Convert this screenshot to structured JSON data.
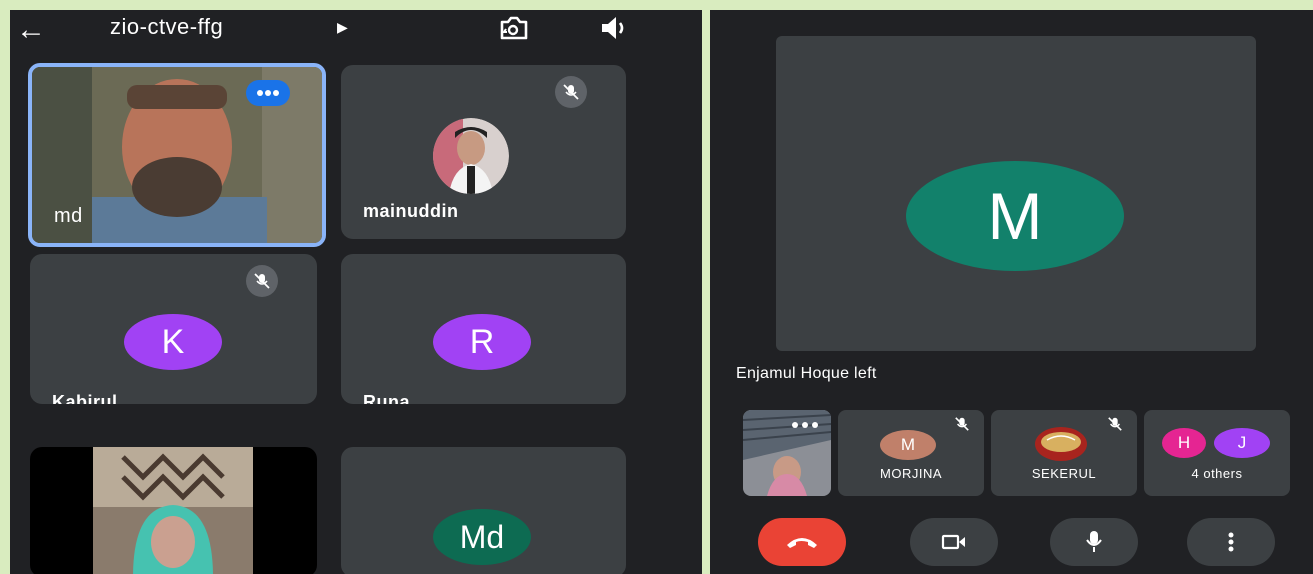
{
  "left_screen": {
    "meeting_code": "zio-ctve-ffg",
    "icons": {
      "back": "arrow-back-icon",
      "caret": "caret-right-icon",
      "flip": "flip-camera-icon",
      "speaker": "speaker-icon"
    },
    "tiles": [
      {
        "name": "md",
        "type": "video",
        "speaking": true
      },
      {
        "name": "mainuddin",
        "type": "photo-avatar",
        "muted": true
      },
      {
        "name": "Kabirul",
        "initial": "K",
        "muted": true,
        "color": "#a142f4"
      },
      {
        "name": "Runa",
        "initial": "R",
        "color": "#a142f4"
      },
      {
        "name": "",
        "type": "video"
      },
      {
        "name": "",
        "initial": "Md",
        "color": "#0d6b52"
      }
    ]
  },
  "right_screen": {
    "main_initial": "M",
    "main_color": "#12816b",
    "notice": "Enjamul Hoque left",
    "participants": [
      {
        "name": "MORJINA",
        "initial": "M",
        "color": "#c0806a",
        "muted": true
      },
      {
        "name": "SEKERUL",
        "muted": true
      },
      {
        "name": "4 others",
        "initials": [
          "H",
          "J"
        ],
        "colors": [
          "#e52592",
          "#a142f4"
        ]
      }
    ],
    "controls": [
      "end-call-icon",
      "camera-icon",
      "microphone-icon",
      "more-vert-icon"
    ],
    "colors": {
      "end_call": "#ea4335",
      "panel_bg": "#202124",
      "tile_bg": "#3c4043"
    }
  }
}
